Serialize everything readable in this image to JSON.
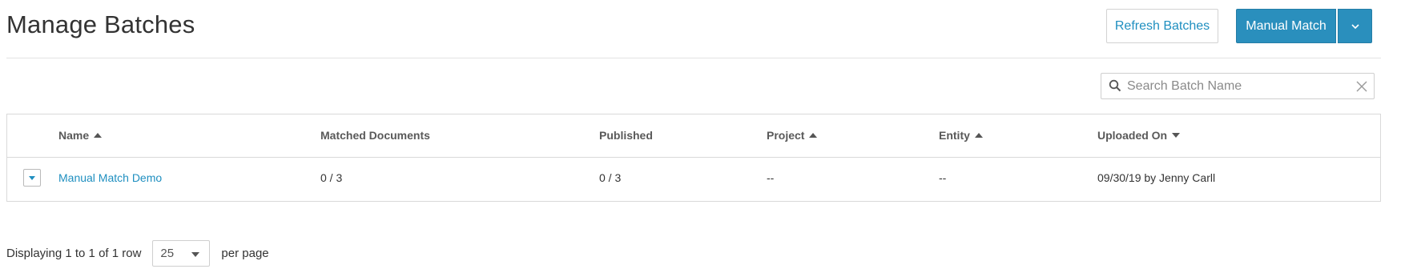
{
  "header": {
    "title": "Manage Batches",
    "refresh_label": "Refresh Batches",
    "manual_match_label": "Manual Match"
  },
  "search": {
    "placeholder": "Search Batch Name",
    "value": ""
  },
  "table": {
    "columns": [
      {
        "label": "Name",
        "sort": "asc"
      },
      {
        "label": "Matched Documents",
        "sort": ""
      },
      {
        "label": "Published",
        "sort": ""
      },
      {
        "label": "Project",
        "sort": "asc"
      },
      {
        "label": "Entity",
        "sort": "asc"
      },
      {
        "label": "Uploaded On",
        "sort": "desc"
      }
    ],
    "rows": [
      {
        "name": "Manual Match Demo",
        "matched_documents": "0 / 3",
        "published": "0 / 3",
        "project": "--",
        "entity": "--",
        "uploaded_on": "09/30/19 by Jenny Carll"
      }
    ]
  },
  "footer": {
    "displaying": "Displaying 1 to 1 of 1 row",
    "per_page_value": "25",
    "per_page_label": "per page"
  },
  "colors": {
    "accent": "#2a8fbd",
    "link": "#1f8fc0",
    "border": "#d9d9d9"
  },
  "icons": [
    "search-icon",
    "clear-icon",
    "chevron-down-icon",
    "sort-asc-icon",
    "sort-desc-icon",
    "expand-row-icon"
  ]
}
